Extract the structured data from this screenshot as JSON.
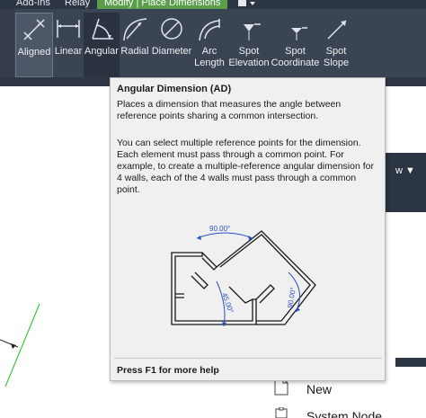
{
  "tabs": [
    {
      "label": "Add-Ins",
      "active": false
    },
    {
      "label": "Relay",
      "active": false
    },
    {
      "label": "Modify | Place Dimensions",
      "active": true
    }
  ],
  "ribbon": {
    "buttons": [
      {
        "label": "Aligned",
        "icon": "aligned-dimension-icon",
        "state": "highlighted"
      },
      {
        "label": "Linear",
        "icon": "linear-dimension-icon",
        "state": "normal"
      },
      {
        "label": "Angular",
        "icon": "angular-dimension-icon",
        "state": "selected"
      },
      {
        "label": "Radial",
        "icon": "radial-dimension-icon",
        "state": "normal"
      },
      {
        "label": "Diameter",
        "icon": "diameter-dimension-icon",
        "state": "normal"
      },
      {
        "label": "Arc\nLength",
        "icon": "arc-length-icon",
        "state": "normal"
      },
      {
        "label": "Spot\nElevation",
        "icon": "spot-elevation-icon",
        "state": "normal"
      },
      {
        "label": "Spot\nCoordinate",
        "icon": "spot-coordinate-icon",
        "state": "normal"
      },
      {
        "label": "Spot\nSlope",
        "icon": "spot-slope-icon",
        "state": "normal"
      }
    ]
  },
  "tooltip": {
    "title": "Angular Dimension (AD)",
    "description": "Places a dimension that measures the angle between reference points sharing a common intersection.",
    "detail": "You can select multiple reference points for the dimension. Each element must pass through a common point. For example, to create a multiple-reference angular dimension for 4 walls, each of the 4 walls must pass through a common point.",
    "illustration_labels": [
      "90.00°",
      "45.00°",
      "90.00°"
    ],
    "footer": "Press F1 for more help"
  },
  "right_panel": {
    "arrow_label": "w ▼",
    "items": [
      {
        "label": "New",
        "icon": "document-icon"
      },
      {
        "label": "System Node",
        "icon": "system-node-icon"
      }
    ]
  },
  "colors": {
    "ribbon_bg": "#3b4453",
    "tab_active": "#5a9e4b",
    "tooltip_bg": "#f0f0f0",
    "dimension_blue": "#2a4fc4",
    "canvas_line": "#3cc43c"
  }
}
